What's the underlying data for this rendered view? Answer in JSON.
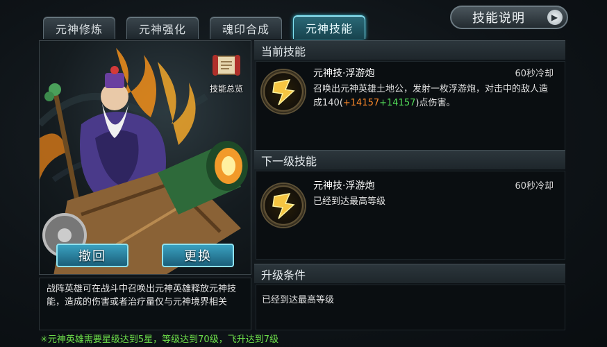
{
  "tabs": [
    {
      "label": "元神修炼",
      "active": false
    },
    {
      "label": "元神强化",
      "active": false
    },
    {
      "label": "魂印合成",
      "active": false
    },
    {
      "label": "元神技能",
      "active": true
    }
  ],
  "help_button": {
    "label": "技能说明",
    "icon": "play-arrow-icon"
  },
  "hero": {
    "overview_label": "技能总览",
    "overview_icon": "scroll-icon",
    "revoke_label": "撤回",
    "replace_label": "更换",
    "description": "战阵英雄可在战斗中召唤出元神英雄释放元神技能，造成的伤害或者治疗量仅与元神境界相关"
  },
  "current_skill": {
    "header": "当前技能",
    "name": "元神技·浮游炮",
    "cooldown": "60秒冷却",
    "desc_prefix": "召唤出元神英雄土地公，发射一枚浮游炮，对击中的敌人造成140(",
    "bonus1": "+14157",
    "bonus2": "+14157",
    "desc_suffix": ")点伤害。"
  },
  "next_skill": {
    "header": "下一级技能",
    "name": "元神技·浮游炮",
    "cooldown": "60秒冷却",
    "desc": "已经到达最高等级"
  },
  "upgrade": {
    "header": "升级条件",
    "desc": "已经到达最高等级"
  },
  "bottom_note": "✳元神英雄需要星级达到5星，等级达到70级，飞升达到7级",
  "colors": {
    "accent": "#7fe0f0",
    "orange": "#ff8a2a",
    "green": "#54e05a",
    "note": "#6ee04a"
  }
}
